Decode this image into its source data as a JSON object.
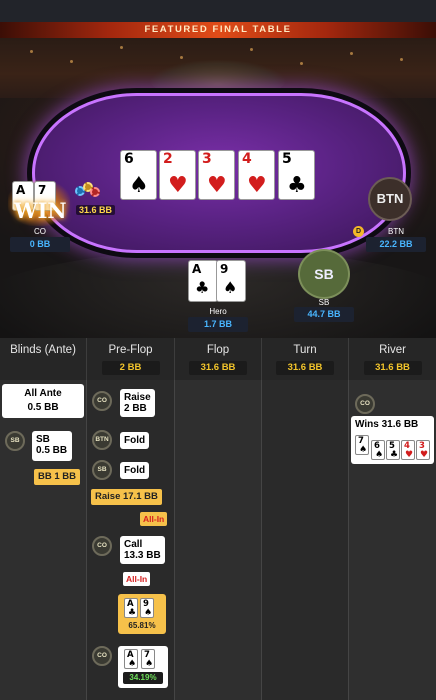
{
  "banner": "FEATURED FINAL TABLE",
  "board": [
    {
      "rank": "6",
      "suit": "♠",
      "color": "black"
    },
    {
      "rank": "2",
      "suit": "♥",
      "color": "red"
    },
    {
      "rank": "3",
      "suit": "♥",
      "color": "red"
    },
    {
      "rank": "4",
      "suit": "♥",
      "color": "red"
    },
    {
      "rank": "5",
      "suit": "♣",
      "color": "black"
    }
  ],
  "seats": {
    "co": {
      "name": "CO",
      "stack": "0 BB",
      "bet": "31.6 BB",
      "win_label": "WIN",
      "cards": [
        {
          "rank": "A",
          "suit": "♠"
        },
        {
          "rank": "7",
          "suit": "♠"
        }
      ]
    },
    "btn": {
      "avatar": "BTN",
      "name": "BTN",
      "stack": "22.2 BB",
      "dealer_mark": "D"
    },
    "hero": {
      "name": "Hero",
      "stack": "1.7 BB",
      "cards": [
        {
          "rank": "A",
          "suit": "♣",
          "color": "black"
        },
        {
          "rank": "9",
          "suit": "♠",
          "color": "black"
        }
      ]
    },
    "sb": {
      "avatar": "SB",
      "name": "SB",
      "stack": "44.7 BB"
    }
  },
  "columns": [
    {
      "title": "Blinds (Ante)",
      "pot": ""
    },
    {
      "title": "Pre-Flop",
      "pot": "2 BB"
    },
    {
      "title": "Flop",
      "pot": "31.6 BB"
    },
    {
      "title": "Turn",
      "pot": "31.6 BB"
    },
    {
      "title": "River",
      "pot": "31.6 BB"
    }
  ],
  "blinds": {
    "ante_title": "All Ante",
    "ante_value": "0.5 BB",
    "sb_chip": "SB",
    "sb_title": "SB",
    "sb_value": "0.5 BB",
    "bb_tag": "BB 1 BB"
  },
  "preflop": {
    "a1_chip": "CO",
    "a1_action": "Raise",
    "a1_amount": "2 BB",
    "a2_chip": "BTN",
    "a2_action": "Fold",
    "a3_chip": "SB",
    "a3_action": "Fold",
    "a4_tag": "Raise 17.1 BB",
    "a4_allin": "All-In",
    "a5_chip": "CO",
    "a5_action": "Call",
    "a5_amount": "13.3 BB",
    "a5_allin": "All-In",
    "hero_cards": [
      {
        "rank": "A",
        "suit": "♣",
        "color": "black"
      },
      {
        "rank": "9",
        "suit": "♠",
        "color": "black"
      }
    ],
    "hero_equity": "65.81%",
    "co_chip": "CO",
    "co_cards": [
      {
        "rank": "A",
        "suit": "♠",
        "color": "black"
      },
      {
        "rank": "7",
        "suit": "♠",
        "color": "black"
      }
    ],
    "co_equity": "34.19%"
  },
  "river": {
    "chip": "CO",
    "wins": "Wins 31.6 BB",
    "cards": [
      {
        "rank": "7",
        "suit": "♠",
        "color": "black"
      },
      {
        "rank": "6",
        "suit": "♠",
        "color": "black"
      },
      {
        "rank": "5",
        "suit": "♣",
        "color": "black"
      },
      {
        "rank": "4",
        "suit": "♥",
        "color": "red"
      },
      {
        "rank": "3",
        "suit": "♥",
        "color": "red"
      }
    ]
  },
  "colors": {
    "pot_gold": "#f3c52b",
    "stack_blue": "#49b6ff",
    "equity_win": "#6fe05a",
    "felt": "#5b2385",
    "rail_glow": "#c874ff"
  }
}
